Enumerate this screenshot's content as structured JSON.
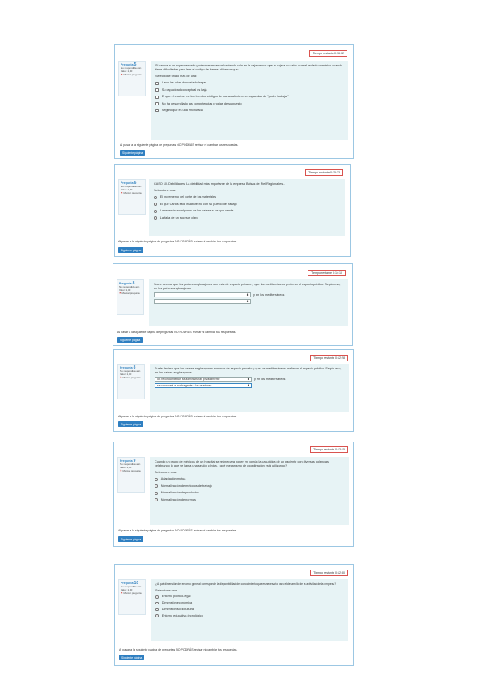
{
  "warning_text": "Al pasar a la siguiente página de preguntas NO PODRÁS revisar ni cambiar tus respuestas.",
  "next_label": "Siguiente página",
  "status_label": "No respondida aún",
  "value_label": "Valor: 1,00",
  "flag_label": "Marcar pregunta",
  "question_prefix": "Pregunta",
  "blocks": [
    {
      "timer": "Tiempo restante 0:16:02",
      "number": "5",
      "question": "Si vamos a un supermercado y mientras estamos haciendo cola en la caja vemos que la cajera no sabe usar el teclado numérico cuando tiene dificultades para leer el código de barras, diríamos que:",
      "select_label": "Seleccione una o más de una:",
      "options": [
        "Lleva las uñas demasiado largas",
        "Su capacidad conceptual es baja",
        "El que el escáner no lea bien los códigos de barras afecta a su capacidad de \"poder trabajar\"",
        "No ha desarrollado las competencias propias de su puesto",
        "Seguro que es una enchufada"
      ]
    },
    {
      "timer": "Tiempo restante 0:15:33",
      "number": "6",
      "question": "CASO 10. Debilidades. La debilidad más importante de la empresa Bolsas de Piel Regional es...",
      "select_label": "Seleccione una:",
      "options": [
        "El incremento del coste de los materiales",
        "El que Carlos está insatisfecho con su puesto de trabajo",
        "La recesión en algunos de los países a los que vende",
        "La falta de un sucesor claro"
      ]
    },
    {
      "timer": "Tiempo restante 0:14:10",
      "number": "8",
      "question": "Suele decirse que los países anglosajones son más de espacio privado y que los mediterráneos prefieren el espacio público. Según eso, en los países anglosajones",
      "dropdowns": [
        "",
        ""
      ],
      "dd_suffix": "y en los mediterráneos"
    },
    {
      "timer": "Tiempo restante 0:12:28",
      "number": "8",
      "question": "Suele decirse que los países anglosajones son más de espacio privado y que los mediterráneos prefieren el espacio público. Según eso, en los países anglosajones",
      "dropdowns": [
        "los reconocimientos se administrarán privadamente",
        "se convocará a mucha gente a las reuniones"
      ],
      "dd_suffix": "y en los mediterráneos"
    },
    {
      "timer": "Tiempo restante 0:13:15",
      "number": "9",
      "question": "Cuando un grupo de médicos de un hospital se reúne para poner en común la casuística de un paciente con diversas dolencias celebrando lo que se llama una sesión clínica, ¿qué mecanismo de coordinación está utilizando?",
      "select_label": "Seleccione una:",
      "options": [
        "Adaptación mutua",
        "Normalización de métodos de trabajo",
        "Normalización de productos",
        "Normalización de normas"
      ]
    },
    {
      "timer": "Tiempo restante 0:12:30",
      "number": "10",
      "question": "¿A qué dimensión del entorno general corresponde la disponibilidad del conocimiento que es necesario para el desarrollo de la actividad de la empresa?",
      "select_label": "Seleccione una:",
      "options": [
        "Entorno político-legal",
        "Dimensión económica",
        "Dimensión sociocultural",
        "Entorno educativo-tecnológico"
      ]
    }
  ]
}
